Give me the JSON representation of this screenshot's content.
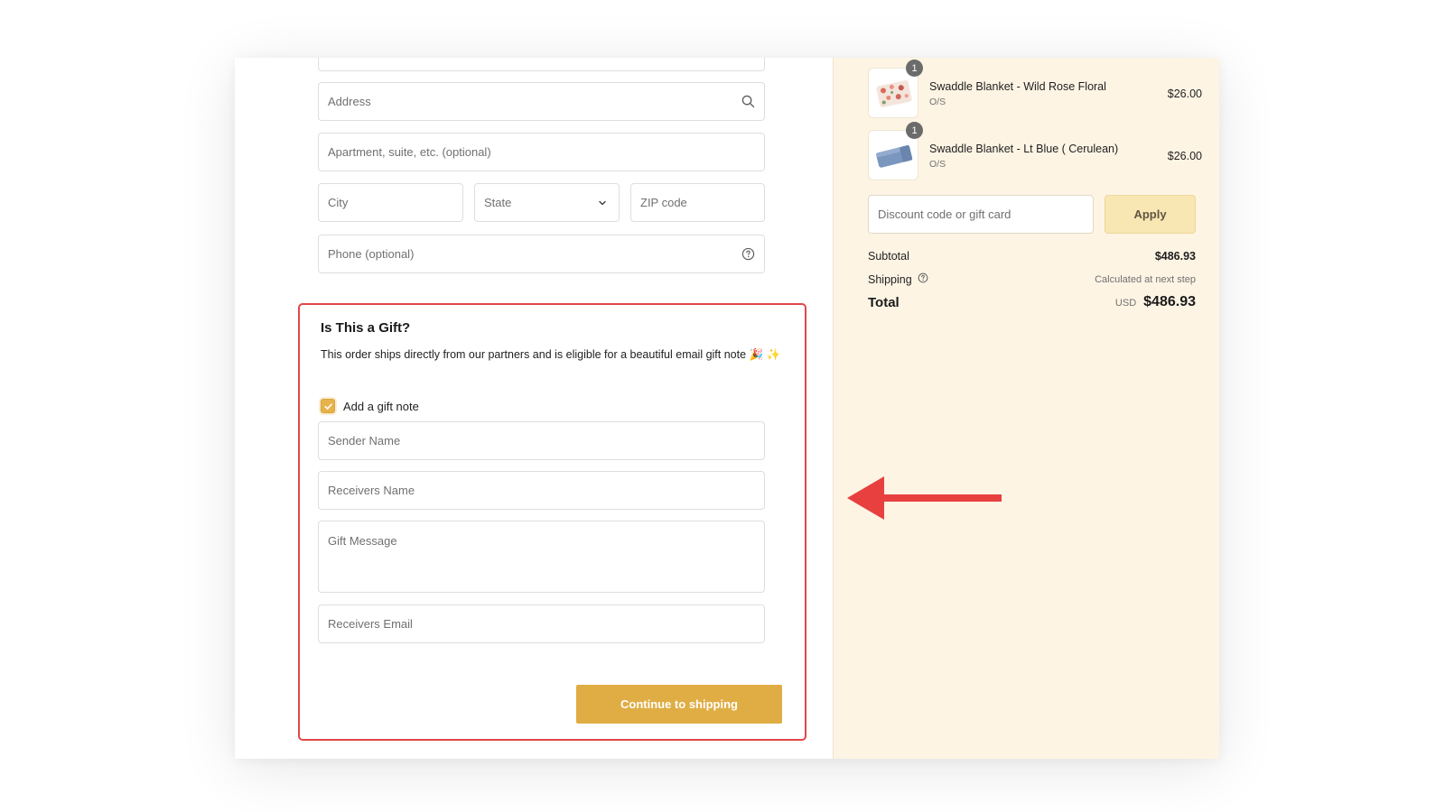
{
  "form": {
    "address_placeholder": "Address",
    "apartment_placeholder": "Apartment, suite, etc. (optional)",
    "city_placeholder": "City",
    "state_value": "State",
    "zip_placeholder": "ZIP code",
    "phone_placeholder": "Phone (optional)"
  },
  "gift": {
    "title": "Is This a Gift?",
    "description": "This order ships directly from our partners and is eligible for a beautiful email gift note 🎉 ✨",
    "checkbox_label": "Add a gift note",
    "checkbox_checked": true,
    "sender_placeholder": "Sender Name",
    "receiver_name_placeholder": "Receivers Name",
    "message_placeholder": "Gift Message",
    "receiver_email_placeholder": "Receivers Email",
    "continue_label": "Continue to shipping"
  },
  "cart": {
    "items": [
      {
        "qty": "1",
        "name": "Swaddle Blanket - Wild Rose Floral",
        "variant": "O/S",
        "price": "$26.00",
        "thumb": "floral-blanket-thumb"
      },
      {
        "qty": "1",
        "name": "Swaddle Blanket - Lt Blue ( Cerulean)",
        "variant": "O/S",
        "price": "$26.00",
        "thumb": "blue-blanket-thumb"
      }
    ],
    "discount_placeholder": "Discount code or gift card",
    "apply_label": "Apply",
    "subtotal_label": "Subtotal",
    "subtotal_value": "$486.93",
    "shipping_label": "Shipping",
    "shipping_value": "Calculated at next step",
    "total_label": "Total",
    "currency": "USD",
    "total_value": "$486.93"
  },
  "colors": {
    "accent": "#e0ad44",
    "highlight_border": "#e04848",
    "sidebar_bg": "#fdf4e4",
    "arrow": "#e8403f"
  }
}
